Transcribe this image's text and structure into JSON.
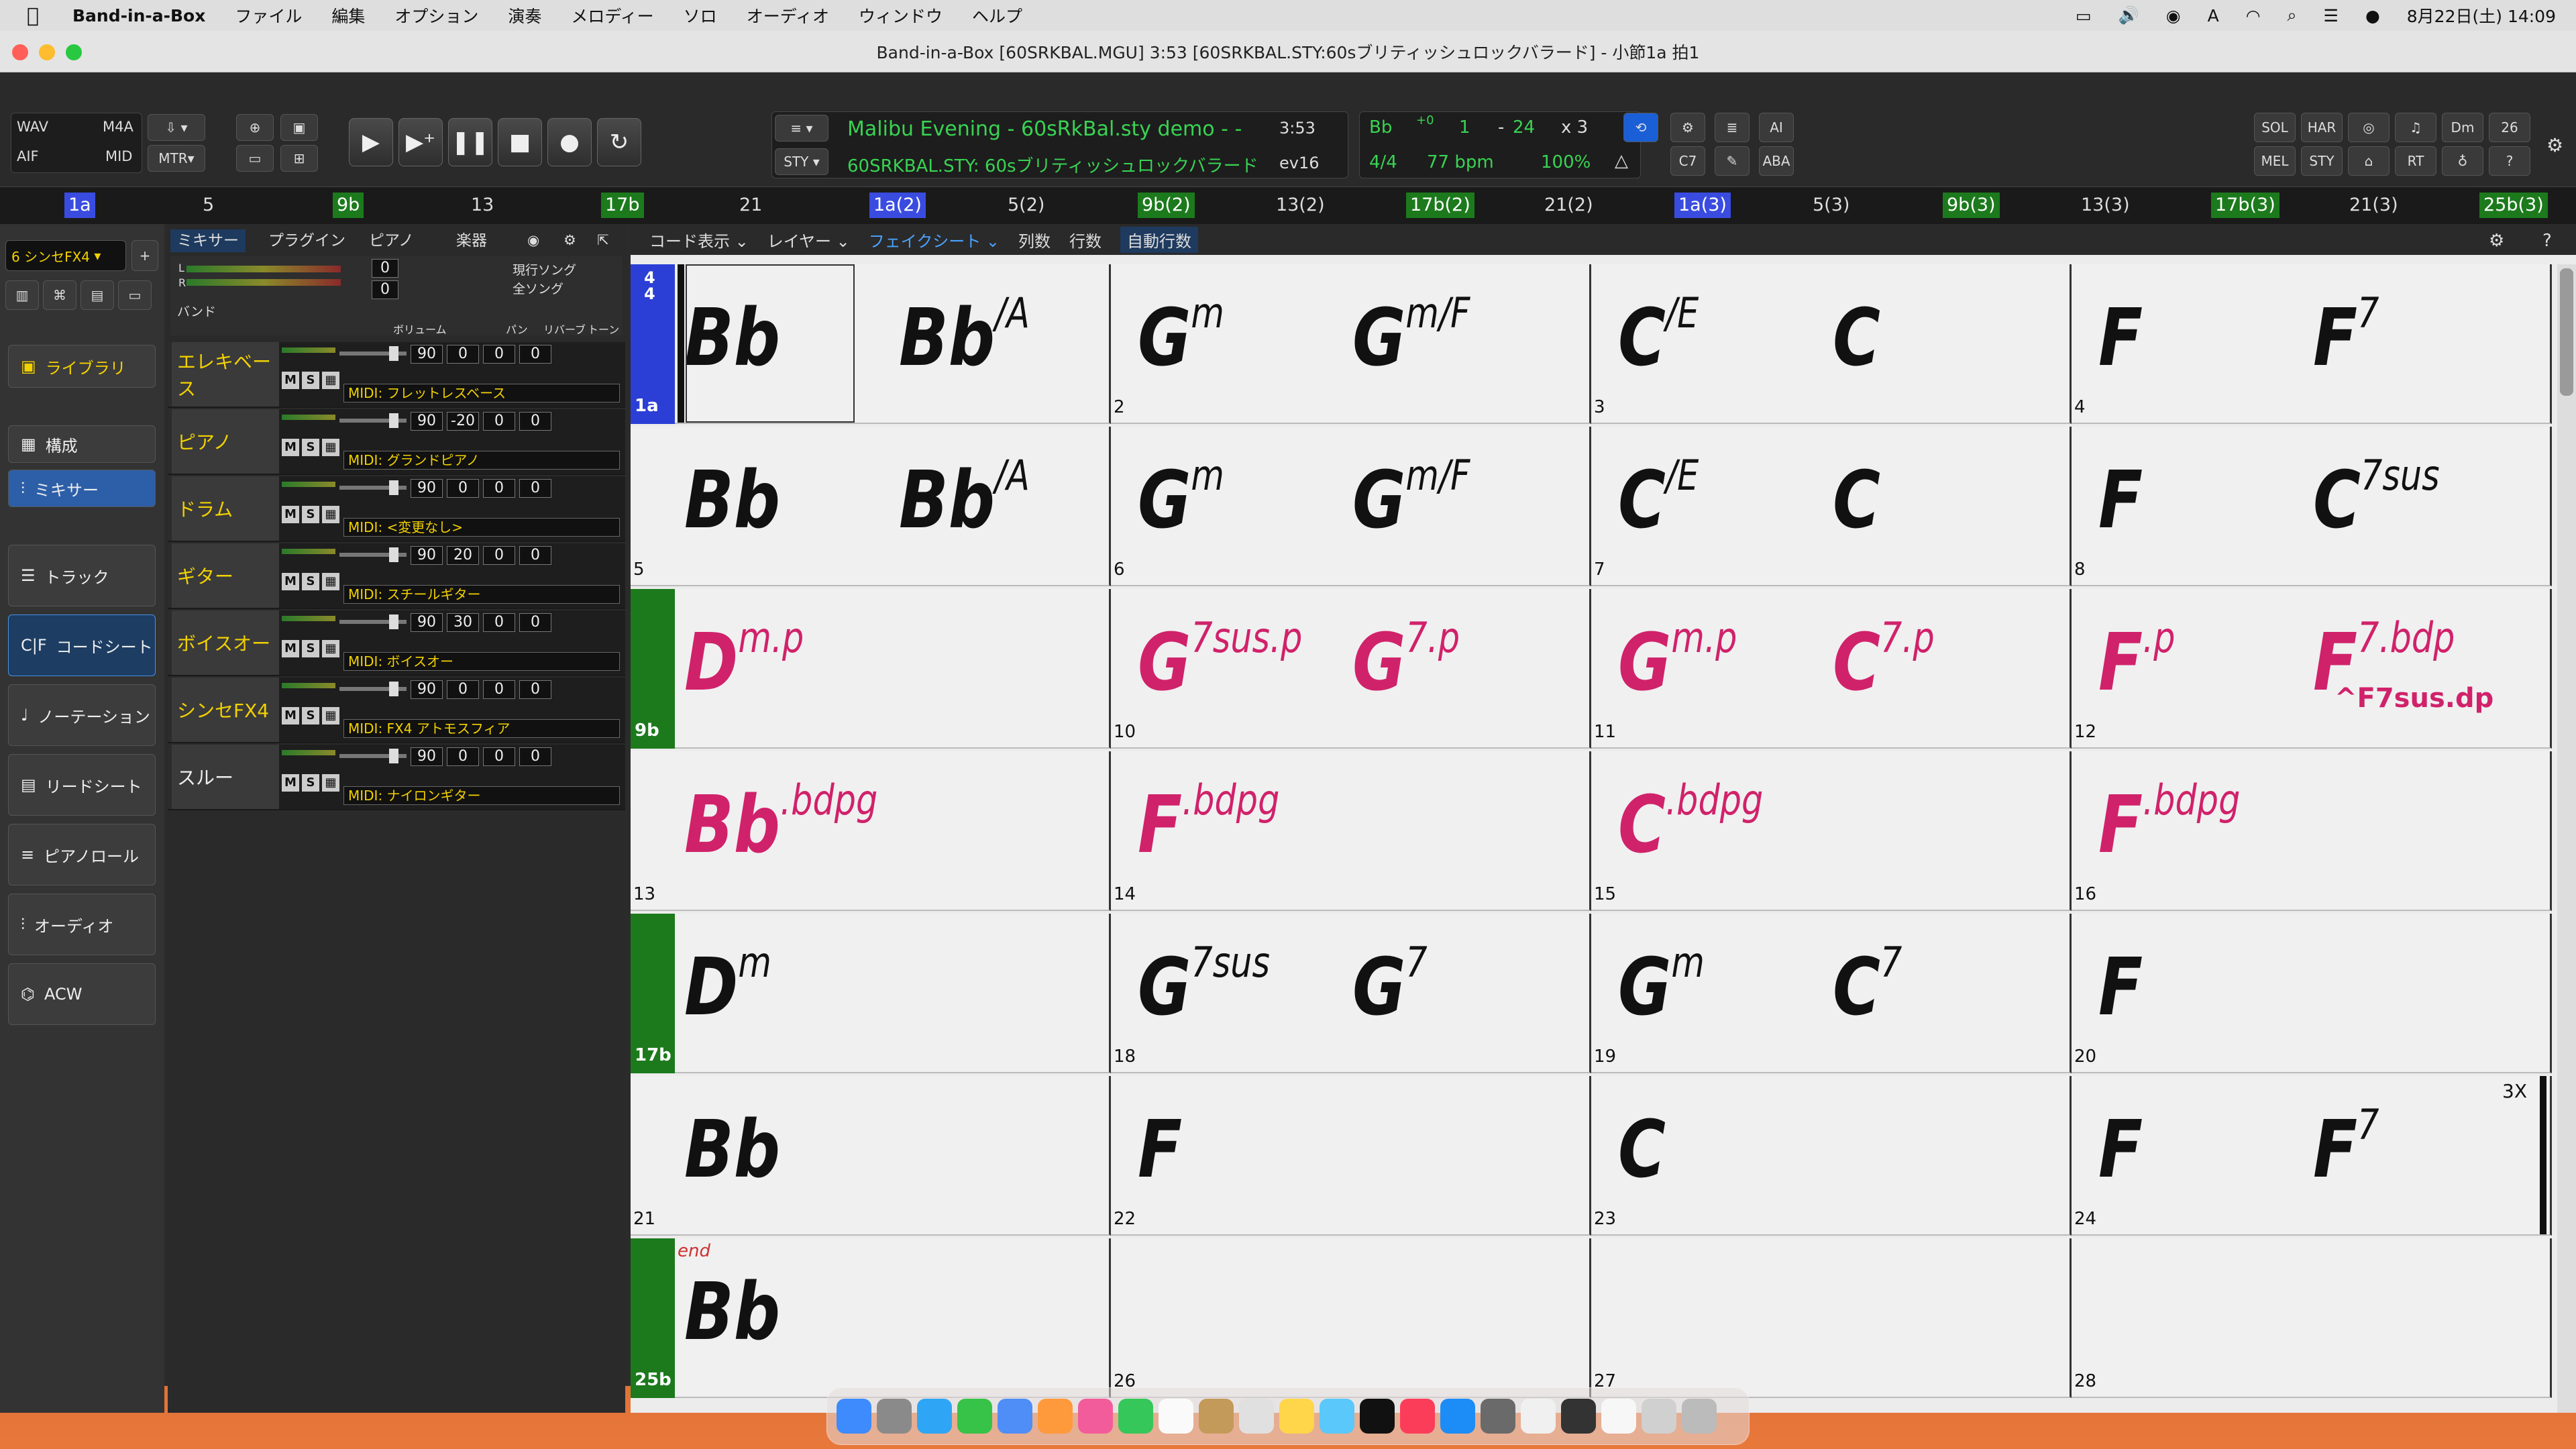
{
  "menubar": {
    "app": "Band-in-a-Box",
    "items": [
      "ファイル",
      "編集",
      "オプション",
      "演奏",
      "メロディー",
      "ソロ",
      "オーディオ",
      "ウィンドウ",
      "ヘルプ"
    ],
    "clock": "8月22日(土)  14:09"
  },
  "window": {
    "title": "Band-in-a-Box [60SRKBAL.MGU]  3:53  [60SRKBAL.STY:60sブリティッシュロックバラード] - 小節1a 拍1"
  },
  "toolbar": {
    "wav": "WAV",
    "m4a": "M4A",
    "aif": "AIF",
    "mid": "MID",
    "mtr": "MTR",
    "song": "Malibu Evening - 60sRkBal.sty demo - -",
    "time": "3:53",
    "style": "60SRKBAL.STY: 60sブリティッシュロックバラード",
    "ev": "ev16",
    "key": "Bb",
    "transpose": "+0",
    "range_start": "1",
    "range_sep": "-",
    "range_end": "24",
    "repeat": "x  3",
    "meter": "4/4",
    "tempo": "77 bpm",
    "percent": "100%",
    "c7": "C7",
    "ai": "AI",
    "aba": "ABA",
    "right": [
      "SOL",
      "HAR",
      "",
      "",
      "Dm",
      "26",
      "MEL",
      "",
      "",
      "RT",
      "",
      ""
    ]
  },
  "ruler": [
    {
      "t": "1a",
      "k": "b"
    },
    {
      "t": "5",
      "k": ""
    },
    {
      "t": "9b",
      "k": "g"
    },
    {
      "t": "13",
      "k": ""
    },
    {
      "t": "17b",
      "k": "g"
    },
    {
      "t": "21",
      "k": ""
    },
    {
      "t": "1a(2)",
      "k": "b"
    },
    {
      "t": "5(2)",
      "k": ""
    },
    {
      "t": "9b(2)",
      "k": "g"
    },
    {
      "t": "13(2)",
      "k": ""
    },
    {
      "t": "17b(2)",
      "k": "g"
    },
    {
      "t": "21(2)",
      "k": ""
    },
    {
      "t": "1a(3)",
      "k": "b"
    },
    {
      "t": "5(3)",
      "k": ""
    },
    {
      "t": "9b(3)",
      "k": "g"
    },
    {
      "t": "13(3)",
      "k": ""
    },
    {
      "t": "17b(3)",
      "k": "g"
    },
    {
      "t": "21(3)",
      "k": ""
    },
    {
      "t": "25b(3)",
      "k": "g"
    }
  ],
  "sidebar": {
    "track_select": "6 シンセFX4",
    "library": "ライブラリ",
    "structure": "構成",
    "mixer": "ミキサー",
    "items": [
      "トラック",
      "コードシート",
      "ノーテーション",
      "リードシート",
      "ピアノロール",
      "オーディオ",
      "ACW"
    ],
    "cf": "C|F"
  },
  "mixer": {
    "tabs": [
      "ミキサー",
      "プラグイン",
      "ピアノ",
      "楽器"
    ],
    "band": "バンド",
    "cur_song": "現行ソング",
    "all_song": "全ソング",
    "vol_label": "ボリューム",
    "pan_label": "パン",
    "rev_label": "リバーブ",
    "tone_label": "トーン",
    "l": "L",
    "r": "R",
    "zero": "0",
    "tracks": [
      {
        "name": "エレキベース",
        "vol": "90",
        "pan": "0",
        "rev": "0",
        "tone": "0",
        "midi": "MIDI: フレットレスベース"
      },
      {
        "name": "ピアノ",
        "vol": "90",
        "pan": "-20",
        "rev": "0",
        "tone": "0",
        "midi": "MIDI: グランドピアノ"
      },
      {
        "name": "ドラム",
        "vol": "90",
        "pan": "0",
        "rev": "0",
        "tone": "0",
        "midi": "MIDI: <変更なし>"
      },
      {
        "name": "ギター",
        "vol": "90",
        "pan": "20",
        "rev": "0",
        "tone": "0",
        "midi": "MIDI: スチールギター"
      },
      {
        "name": "ボイスオー",
        "vol": "90",
        "pan": "30",
        "rev": "0",
        "tone": "0",
        "midi": "MIDI: ボイスオー"
      },
      {
        "name": "シンセFX4",
        "vol": "90",
        "pan": "0",
        "rev": "0",
        "tone": "0",
        "midi": "MIDI: FX4 アトモスフィア"
      },
      {
        "name": "スルー",
        "vol": "90",
        "pan": "0",
        "rev": "0",
        "tone": "0",
        "midi": "MIDI: ナイロンギター"
      }
    ]
  },
  "sheet": {
    "hdr": [
      "コード表示 ⌄",
      "レイヤー ⌄",
      "フェイクシート ⌄",
      "列数",
      "行数",
      "自動行数"
    ],
    "rows": [
      {
        "sec": "1a",
        "secColor": "#2b3fd6",
        "bars": [
          {
            "n": "1a",
            "c": [
              [
                "Bb",
                ""
              ],
              [
                "Bb",
                "/A"
              ]
            ]
          },
          {
            "n": "2",
            "c": [
              [
                "G",
                "m"
              ],
              [
                "G",
                "m/F"
              ]
            ]
          },
          {
            "n": "3",
            "c": [
              [
                "C",
                "/E"
              ],
              [
                "C",
                ""
              ]
            ]
          },
          {
            "n": "4",
            "c": [
              [
                "F",
                ""
              ],
              [
                "F",
                "7"
              ]
            ]
          }
        ]
      },
      {
        "sec": "",
        "bars": [
          {
            "n": "5",
            "c": [
              [
                "Bb",
                ""
              ],
              [
                "Bb",
                "/A"
              ]
            ]
          },
          {
            "n": "6",
            "c": [
              [
                "G",
                "m"
              ],
              [
                "G",
                "m/F"
              ]
            ]
          },
          {
            "n": "7",
            "c": [
              [
                "C",
                "/E"
              ],
              [
                "C",
                ""
              ]
            ]
          },
          {
            "n": "8",
            "c": [
              [
                "F",
                ""
              ],
              [
                "C",
                "7sus"
              ]
            ]
          }
        ]
      },
      {
        "sec": "9b",
        "secColor": "#1c7a1c",
        "pink": true,
        "bars": [
          {
            "n": "",
            "c": [
              [
                "D",
                "m.p"
              ]
            ]
          },
          {
            "n": "10",
            "c": [
              [
                "G",
                "7sus.p"
              ],
              [
                "G",
                "7.p"
              ]
            ]
          },
          {
            "n": "11",
            "c": [
              [
                "G",
                "m.p"
              ],
              [
                "C",
                "7.p"
              ]
            ]
          },
          {
            "n": "12",
            "c": [
              [
                "F",
                ".p"
              ],
              [
                "F",
                "7.bdp"
              ]
            ]
          }
        ]
      },
      {
        "sec": "",
        "pink": true,
        "bars": [
          {
            "n": "13",
            "c": [
              [
                "Bb",
                ".bdpg"
              ]
            ]
          },
          {
            "n": "14",
            "c": [
              [
                "F",
                ".bdpg"
              ]
            ]
          },
          {
            "n": "15",
            "c": [
              [
                "C",
                ".bdpg"
              ]
            ]
          },
          {
            "n": "16",
            "c": [
              [
                "F",
                ".bdpg"
              ]
            ]
          }
        ]
      },
      {
        "sec": "17b",
        "secColor": "#1c7a1c",
        "bars": [
          {
            "n": "",
            "c": [
              [
                "D",
                "m"
              ]
            ]
          },
          {
            "n": "18",
            "c": [
              [
                "G",
                "7sus"
              ],
              [
                "G",
                "7"
              ]
            ]
          },
          {
            "n": "19",
            "c": [
              [
                "G",
                "m"
              ],
              [
                "C",
                "7"
              ]
            ]
          },
          {
            "n": "20",
            "c": [
              [
                "F",
                ""
              ]
            ]
          }
        ]
      },
      {
        "sec": "",
        "bars": [
          {
            "n": "21",
            "c": [
              [
                "Bb",
                ""
              ]
            ]
          },
          {
            "n": "22",
            "c": [
              [
                "F",
                ""
              ]
            ]
          },
          {
            "n": "23",
            "c": [
              [
                "C",
                ""
              ]
            ]
          },
          {
            "n": "24",
            "c": [
              [
                "F",
                ""
              ],
              [
                "F",
                "7"
              ]
            ]
          }
        ]
      },
      {
        "sec": "25b",
        "secColor": "#1c7a1c",
        "bars": [
          {
            "n": "",
            "c": [
              [
                "Bb",
                ""
              ]
            ]
          },
          {
            "n": "26",
            "c": []
          },
          {
            "n": "27",
            "c": []
          },
          {
            "n": "28",
            "c": []
          }
        ]
      }
    ],
    "extra": {
      "grace": "^F7sus.dp",
      "rep": "3X",
      "end": "end",
      "timesig_top": "4",
      "timesig_bottom": "4"
    }
  },
  "colors": {
    "pink": "#d0226a",
    "section_green": "#1c7a1c",
    "section_blue": "#2b3fd6"
  }
}
